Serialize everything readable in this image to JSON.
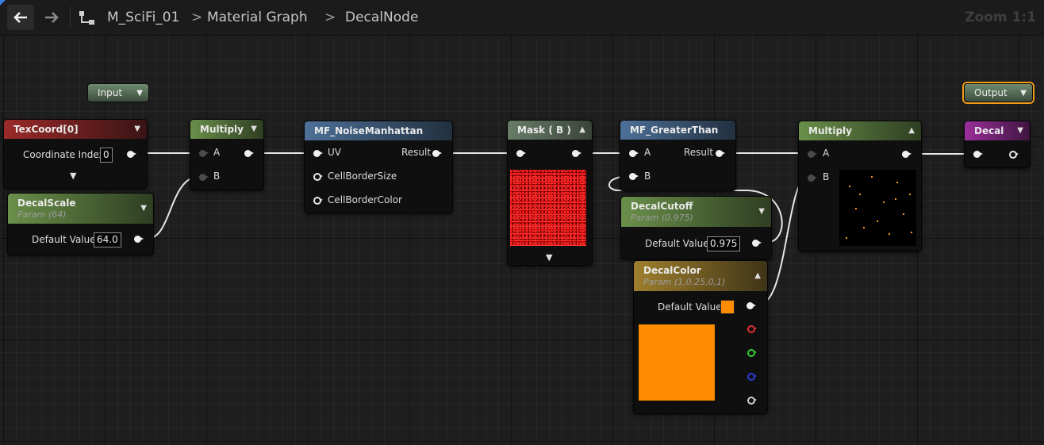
{
  "toolbar": {
    "back_icon": "arrow-left-icon",
    "forward_icon": "arrow-right-icon",
    "graph_icon": "graph-hierarchy-icon",
    "breadcrumbs": [
      "M_SciFi_01",
      "Material Graph",
      "DecalNode"
    ],
    "zoom": "Zoom 1:1"
  },
  "graph": {
    "input_pill": "Input",
    "output_pill": "Output",
    "nodes": {
      "texcoord": {
        "title": "TexCoord[0]",
        "label": "Coordinate Index",
        "value": "0"
      },
      "decalscale": {
        "title": "DecalScale",
        "subtitle": "Param (64)",
        "label": "Default Value",
        "value": "64.0"
      },
      "multiply1": {
        "title": "Multiply",
        "pin_a": "A",
        "pin_b": "B"
      },
      "noise": {
        "title": "MF_NoiseManhattan",
        "pin_uv": "UV",
        "result": "Result",
        "pin_border_size": "CellBorderSize",
        "pin_border_color": "CellBorderColor"
      },
      "mask": {
        "title": "Mask ( B )"
      },
      "greater": {
        "title": "MF_GreaterThan",
        "pin_a": "A",
        "pin_b": "B",
        "result": "Result"
      },
      "cutoff": {
        "title": "DecalCutoff",
        "subtitle": "Param (0.975)",
        "label": "Default Value",
        "value": "0.975"
      },
      "multiply2": {
        "title": "Multiply",
        "pin_a": "A",
        "pin_b": "B"
      },
      "decalcolor": {
        "title": "DecalColor",
        "subtitle": "Param (1,0.25,0,1)",
        "label": "Default Value",
        "color": "#ff8c00"
      },
      "decal": {
        "title": "Decal"
      }
    }
  },
  "colors": {
    "canvas": "#1e1e1e",
    "accent_selection": "#f29a1a",
    "decal_color": "#ff8c00",
    "mask_preview": "#c30000"
  }
}
